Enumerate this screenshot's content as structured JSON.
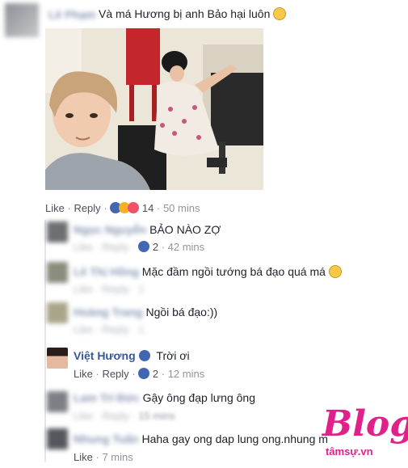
{
  "top_comment": {
    "author": "Lê Phạm",
    "text": "Và má Hương bị anh Bảo hại luôn",
    "photo_alt": "selfie photo",
    "actions": {
      "like": "Like",
      "reply": "Reply"
    },
    "reaction_count": "14",
    "time": "50 mins"
  },
  "replies": [
    {
      "author": "Ngọc Nguyễn",
      "text": "BẢO NÀO ZỢ",
      "reaction_count": "2",
      "time": "42 mins",
      "blurred": true
    },
    {
      "author": "Lê Thị Hồng",
      "text": "Mặc đầm ngồi tướng bá đạo quá má",
      "blurred": true
    },
    {
      "author": "Hoàng Trang",
      "text": "Ngồi bá đạo:))",
      "blurred": true
    },
    {
      "author": "Việt Hương",
      "text": "Trời ơi",
      "verified": true,
      "like": "Like",
      "reply": "Reply",
      "reaction_count": "2",
      "time": "12 mins"
    },
    {
      "author": "Lam Trí Đức",
      "text": "Gậy ông đạp lưng ông",
      "time": "15 mins",
      "blurred": true
    },
    {
      "author": "Nhung Tuấn",
      "text": "Haha gay ong dap lung ong.nhung m",
      "like": "Like",
      "time": "7 mins",
      "blurred": true
    }
  ],
  "watermark": {
    "main": "Blog",
    "sub": "tâmsự.vn"
  },
  "colors": {
    "link": "#365899",
    "meta": "#90949c",
    "watermark": "#e0218a",
    "like_blue": "#4267b2"
  }
}
